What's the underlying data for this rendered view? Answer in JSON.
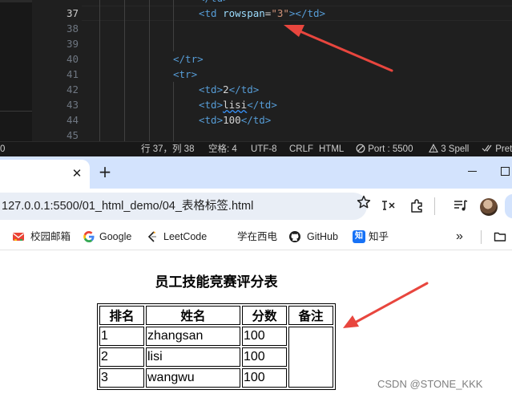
{
  "editor": {
    "line_numbers": [
      "37",
      "38",
      "39",
      "40",
      "41",
      "42",
      "43",
      "44",
      "45"
    ],
    "active_line": "37",
    "line37": {
      "open": "<td",
      "attr": "rowspan",
      "eq": "=",
      "value": "\"3\"",
      "close": "></td>"
    },
    "line40": "</tr>",
    "line41": "<tr>",
    "line42": {
      "open": "<td>",
      "text": "2",
      "close": "</td>"
    },
    "line43": {
      "open": "<td>",
      "text": "lisi",
      "close": "</td>"
    },
    "line44": {
      "open": "<td>",
      "text": "100",
      "close": "</td>"
    }
  },
  "statusbar": {
    "left_number": "0",
    "position": "行 37，列 38",
    "spaces": "空格: 4",
    "encoding": "UTF-8",
    "eol": "CRLF",
    "language": "HTML",
    "port": "Port : 5500",
    "spell": "3 Spell",
    "prettier": "Pret"
  },
  "browser": {
    "url": "127.0.0.1:5500/01_html_demo/04_表格标签.html",
    "bookmarks": [
      {
        "label": "校园邮箱",
        "icon": "mail-icon"
      },
      {
        "label": "Google",
        "icon": "google-icon"
      },
      {
        "label": "LeetCode",
        "icon": "leetcode-icon"
      },
      {
        "label": "学在西电",
        "icon": "blank-icon"
      },
      {
        "label": "GitHub",
        "icon": "github-icon"
      },
      {
        "label": "知乎",
        "icon": "zhihu-icon"
      }
    ],
    "overflow": "»"
  },
  "page": {
    "title": "员工技能竞赛评分表",
    "table": {
      "headers": [
        "排名",
        "姓名",
        "分数",
        "备注"
      ],
      "rows": [
        [
          "1",
          "zhangsan",
          "100"
        ],
        [
          "2",
          "lisi",
          "100"
        ],
        [
          "3",
          "wangwu",
          "100"
        ]
      ]
    },
    "watermark": "CSDN @STONE_KKK"
  },
  "colors": {
    "editor_bg": "#1f1f1f",
    "tag": "#569cd6",
    "attr": "#9cdcfe",
    "string": "#ce9178",
    "arrow": "#e8463e",
    "tabstrip": "#d3e3fd"
  }
}
